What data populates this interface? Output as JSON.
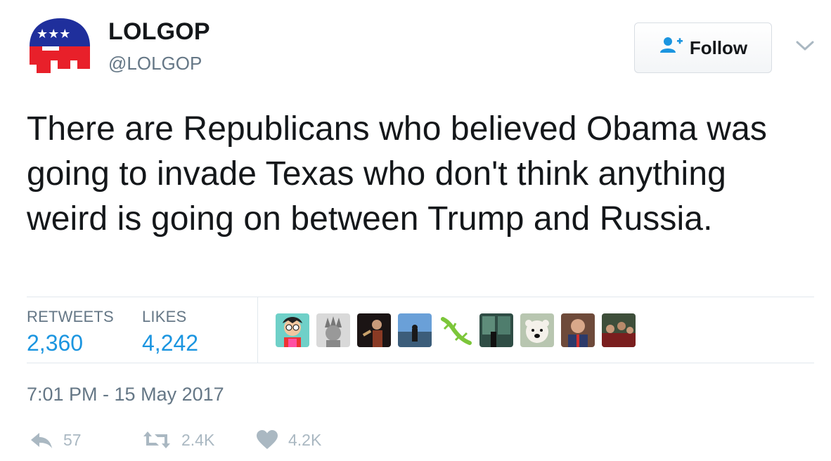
{
  "author": {
    "name": "LOLGOP",
    "handle": "@LOLGOP",
    "avatar_icon": "gop-elephant-logo"
  },
  "follow_button": {
    "label": "Follow",
    "icon": "add-user-icon"
  },
  "menu_icon": "chevron-down-icon",
  "tweet": {
    "text": "There are Republicans who believed Obama was going to invade Texas who don't think anything weird is going on between Trump and Russia."
  },
  "stats": {
    "retweets_label": "RETWEETS",
    "retweets_value": "2,360",
    "likes_label": "LIKES",
    "likes_value": "4,242"
  },
  "likers": [
    {
      "icon": "cartoon-avatar"
    },
    {
      "icon": "statue-avatar"
    },
    {
      "icon": "musician-avatar"
    },
    {
      "icon": "landscape-avatar"
    },
    {
      "icon": "lizard-avatar"
    },
    {
      "icon": "aquarium-avatar"
    },
    {
      "icon": "polar-bear-avatar"
    },
    {
      "icon": "person-avatar"
    },
    {
      "icon": "crowd-avatar"
    }
  ],
  "timestamp": "7:01 PM - 15 May 2017",
  "actions": {
    "reply_count": "57",
    "retweet_count": "2.4K",
    "like_count": "4.2K"
  },
  "colors": {
    "accent": "#1b95e0",
    "muted": "#657786",
    "icon_gray": "#aab8c2",
    "text": "#14171a"
  }
}
